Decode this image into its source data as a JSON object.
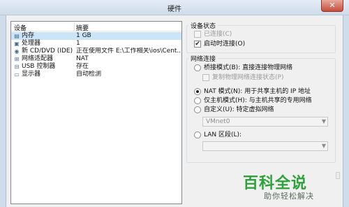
{
  "window": {
    "title": "硬件",
    "close_glyph": "✕"
  },
  "device_list": {
    "columns": {
      "device": "设备",
      "summary": "摘要"
    },
    "rows": [
      {
        "icon": "memory-icon",
        "glyph": "▤",
        "name": "内存",
        "value": "1 GB",
        "selected": true
      },
      {
        "icon": "cpu-icon",
        "glyph": "▣",
        "name": "处理器",
        "value": "1",
        "selected": false
      },
      {
        "icon": "cdrom-icon",
        "glyph": "◉",
        "name": "新 CD/DVD (IDE)",
        "value": "正在使用文件 E:\\工作相关\\ios\\Cent...",
        "selected": false
      },
      {
        "icon": "network-adapter-icon",
        "glyph": "⊞",
        "name": "网络适配器",
        "value": "NAT",
        "selected": false
      },
      {
        "icon": "usb-icon",
        "glyph": "⊟",
        "name": "USB 控制器",
        "value": "存在",
        "selected": false
      },
      {
        "icon": "display-icon",
        "glyph": "▭",
        "name": "显示器",
        "value": "自动检测",
        "selected": false
      }
    ]
  },
  "device_status": {
    "title": "设备状态",
    "connected": {
      "label": "已连接(C)",
      "checked": false,
      "disabled": true
    },
    "connect_on_power_on": {
      "label": "启动时连接(O)",
      "checked": true,
      "disabled": false,
      "check_glyph": "✔"
    }
  },
  "network_connection": {
    "title": "网络连接",
    "bridged": {
      "label": "桥接模式(B): 直接连接物理网络",
      "checked": false
    },
    "replicate_state": {
      "label": "复制物理网络连接状态(P)",
      "disabled": true
    },
    "nat": {
      "label": "NAT 模式(N): 用于共享主机的 IP 地址",
      "checked": true
    },
    "host_only": {
      "label": "仅主机模式(H): 与主机共享的专用网络",
      "checked": false
    },
    "custom": {
      "label": "自定义(U): 特定虚拟网络",
      "checked": false
    },
    "custom_select": {
      "value": "VMnet0",
      "arrow": "▼"
    },
    "lan_segment": {
      "label": "LAN 区段(L):",
      "checked": false
    },
    "lan_select": {
      "value": "",
      "arrow": "▼"
    }
  },
  "watermark": {
    "main": "百科全说",
    "sub": "助你轻松解决"
  }
}
